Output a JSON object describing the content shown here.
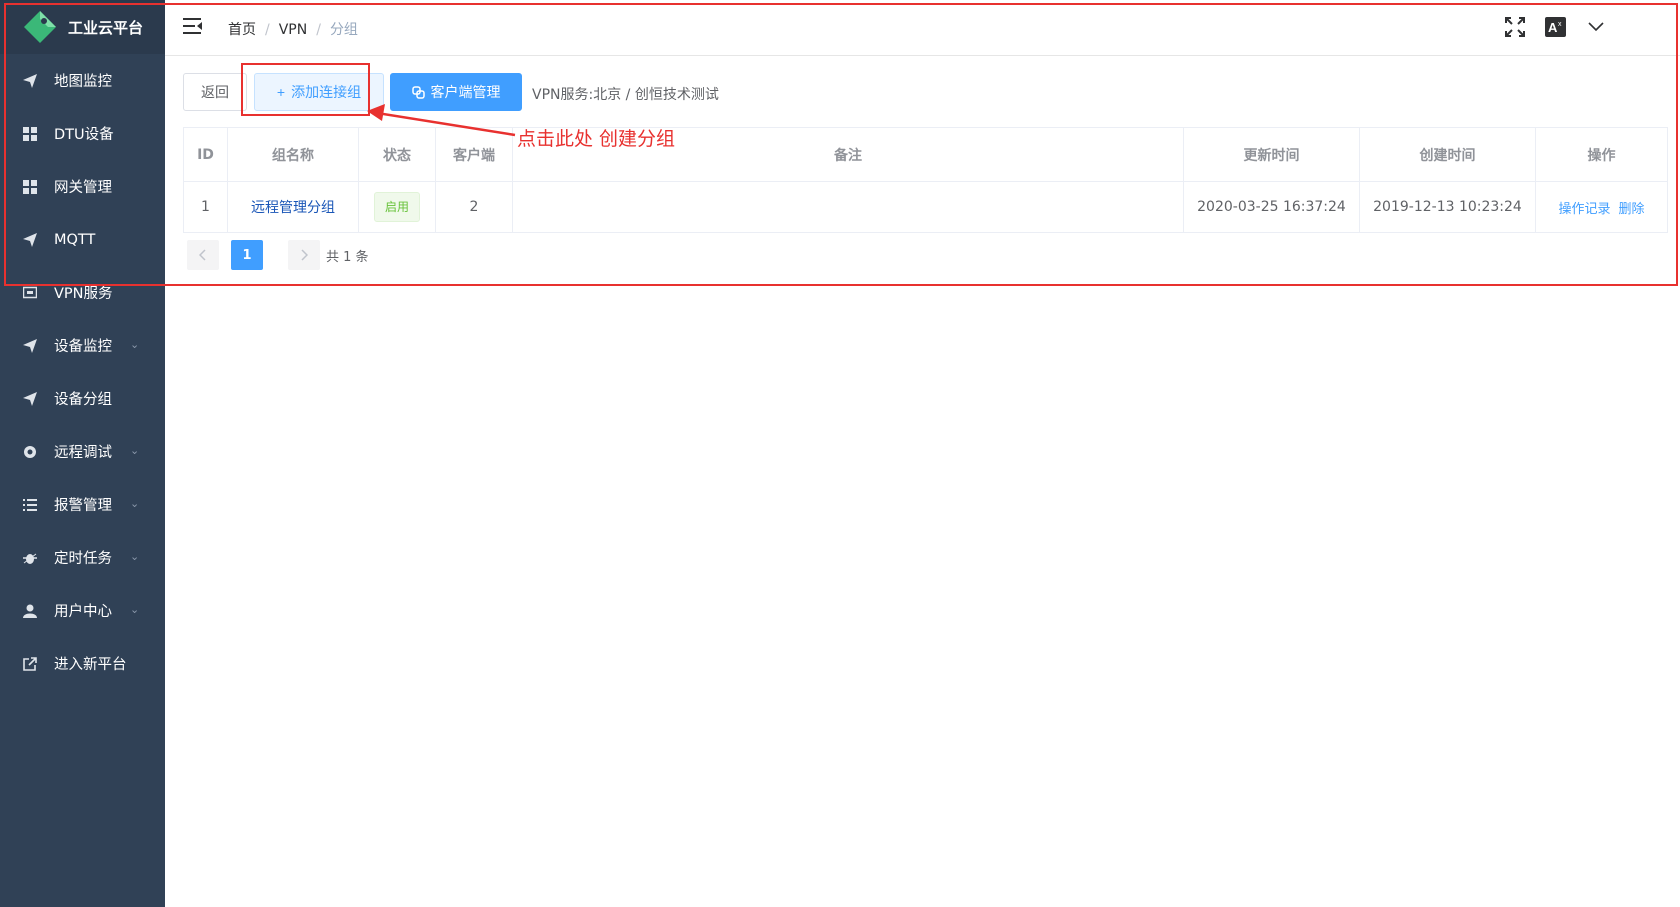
{
  "app": {
    "title": "工业云平台"
  },
  "sidebar": {
    "items": [
      {
        "label": "地图监控",
        "icon": "send-icon",
        "has_children": false
      },
      {
        "label": "DTU设备",
        "icon": "grid-icon",
        "has_children": false
      },
      {
        "label": "网关管理",
        "icon": "grid-icon",
        "has_children": false
      },
      {
        "label": "MQTT",
        "icon": "send-icon",
        "has_children": false
      },
      {
        "label": "VPN服务",
        "icon": "monitor-icon",
        "has_children": false
      },
      {
        "label": "设备监控",
        "icon": "send-icon",
        "has_children": true
      },
      {
        "label": "设备分组",
        "icon": "send-icon",
        "has_children": false
      },
      {
        "label": "远程调试",
        "icon": "settings-icon",
        "has_children": true
      },
      {
        "label": "报警管理",
        "icon": "list-icon",
        "has_children": true
      },
      {
        "label": "定时任务",
        "icon": "bug-icon",
        "has_children": true
      },
      {
        "label": "用户中心",
        "icon": "user-icon",
        "has_children": true
      },
      {
        "label": "进入新平台",
        "icon": "external-link-icon",
        "has_children": false
      }
    ]
  },
  "header": {
    "breadcrumb": [
      "首页",
      "VPN",
      "分组"
    ],
    "separator": "/"
  },
  "toolbar": {
    "back_label": "返回",
    "add_label": "添加连接组",
    "add_prefix": "+",
    "client_label": "客户端管理",
    "vpn_info": "VPN服务:北京 / 创恒技术测试"
  },
  "table": {
    "columns": [
      "ID",
      "组名称",
      "状态",
      "客户端",
      "备注",
      "更新时间",
      "创建时间",
      "操作"
    ],
    "rows": [
      {
        "id": "1",
        "name": "远程管理分组",
        "status": "启用",
        "clients": "2",
        "remark": "",
        "updated": "2020-03-25 16:37:24",
        "created": "2019-12-13 10:23:24",
        "actions": [
          "操作记录",
          "删除"
        ]
      }
    ]
  },
  "pagination": {
    "current": "1",
    "total_text": "共 1 条"
  },
  "annotation": {
    "text": "点击此处 创建分组",
    "color": "#e8312f"
  },
  "colors": {
    "sidebar_bg": "#304156",
    "primary": "#409eff",
    "success": "#67c23a",
    "annotation_red": "#e8312f"
  }
}
